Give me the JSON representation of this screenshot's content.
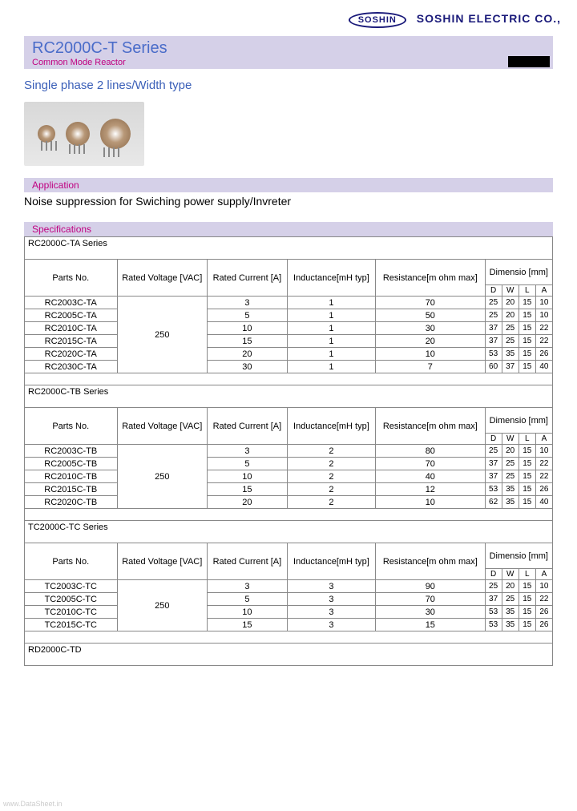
{
  "header": {
    "logo_text": "SOSHIN",
    "company": "SOSHIN ELECTRIC CO.,"
  },
  "title": {
    "series": "RC2000C-T Series",
    "subtitle": "Common Mode Reactor"
  },
  "subtitle_blue": "Single phase 2 lines/Width type",
  "application": {
    "header": "Application",
    "text": "Noise suppression for Swiching power supply/Invreter"
  },
  "specs_header": "Specifications",
  "columns": {
    "parts_no": "Parts No.",
    "rated_voltage": "Rated Voltage [VAC]",
    "rated_current": "Rated Current [A]",
    "inductance": "Inductance[mH typ]",
    "resistance": "Resistance[m ohm max]",
    "dimensions": "Dimensio [mm]",
    "dim_D": "D",
    "dim_W": "W",
    "dim_L": "L",
    "dim_A": "A"
  },
  "tables": [
    {
      "series": "RC2000C-TA Series",
      "voltage": "250",
      "rows": [
        {
          "part": "RC2003C-TA",
          "current": "3",
          "ind": "1",
          "res": "70",
          "d": "25",
          "w": "20",
          "l": "15",
          "a": "10"
        },
        {
          "part": "RC2005C-TA",
          "current": "5",
          "ind": "1",
          "res": "50",
          "d": "25",
          "w": "20",
          "l": "15",
          "a": "10"
        },
        {
          "part": "RC2010C-TA",
          "current": "10",
          "ind": "1",
          "res": "30",
          "d": "37",
          "w": "25",
          "l": "15",
          "a": "22"
        },
        {
          "part": "RC2015C-TA",
          "current": "15",
          "ind": "1",
          "res": "20",
          "d": "37",
          "w": "25",
          "l": "15",
          "a": "22"
        },
        {
          "part": "RC2020C-TA",
          "current": "20",
          "ind": "1",
          "res": "10",
          "d": "53",
          "w": "35",
          "l": "15",
          "a": "26"
        },
        {
          "part": "RC2030C-TA",
          "current": "30",
          "ind": "1",
          "res": "7",
          "d": "60",
          "w": "37",
          "l": "15",
          "a": "40"
        }
      ]
    },
    {
      "series": "RC2000C-TB Series",
      "voltage": "250",
      "rows": [
        {
          "part": "RC2003C-TB",
          "current": "3",
          "ind": "2",
          "res": "80",
          "d": "25",
          "w": "20",
          "l": "15",
          "a": "10"
        },
        {
          "part": "RC2005C-TB",
          "current": "5",
          "ind": "2",
          "res": "70",
          "d": "37",
          "w": "25",
          "l": "15",
          "a": "22"
        },
        {
          "part": "RC2010C-TB",
          "current": "10",
          "ind": "2",
          "res": "40",
          "d": "37",
          "w": "25",
          "l": "15",
          "a": "22"
        },
        {
          "part": "RC2015C-TB",
          "current": "15",
          "ind": "2",
          "res": "12",
          "d": "53",
          "w": "35",
          "l": "15",
          "a": "26"
        },
        {
          "part": "RC2020C-TB",
          "current": "20",
          "ind": "2",
          "res": "10",
          "d": "62",
          "w": "35",
          "l": "15",
          "a": "40"
        }
      ]
    },
    {
      "series": "TC2000C-TC Series",
      "voltage": "250",
      "rows": [
        {
          "part": "TC2003C-TC",
          "current": "3",
          "ind": "3",
          "res": "90",
          "d": "25",
          "w": "20",
          "l": "15",
          "a": "10"
        },
        {
          "part": "TC2005C-TC",
          "current": "5",
          "ind": "3",
          "res": "70",
          "d": "37",
          "w": "25",
          "l": "15",
          "a": "22"
        },
        {
          "part": "TC2010C-TC",
          "current": "10",
          "ind": "3",
          "res": "30",
          "d": "53",
          "w": "35",
          "l": "15",
          "a": "26"
        },
        {
          "part": "TC2015C-TC",
          "current": "15",
          "ind": "3",
          "res": "15",
          "d": "53",
          "w": "35",
          "l": "15",
          "a": "26"
        }
      ]
    },
    {
      "series": "RD2000C-TD",
      "voltage": "",
      "rows": []
    }
  ],
  "watermark": "www.DataSheet.in"
}
